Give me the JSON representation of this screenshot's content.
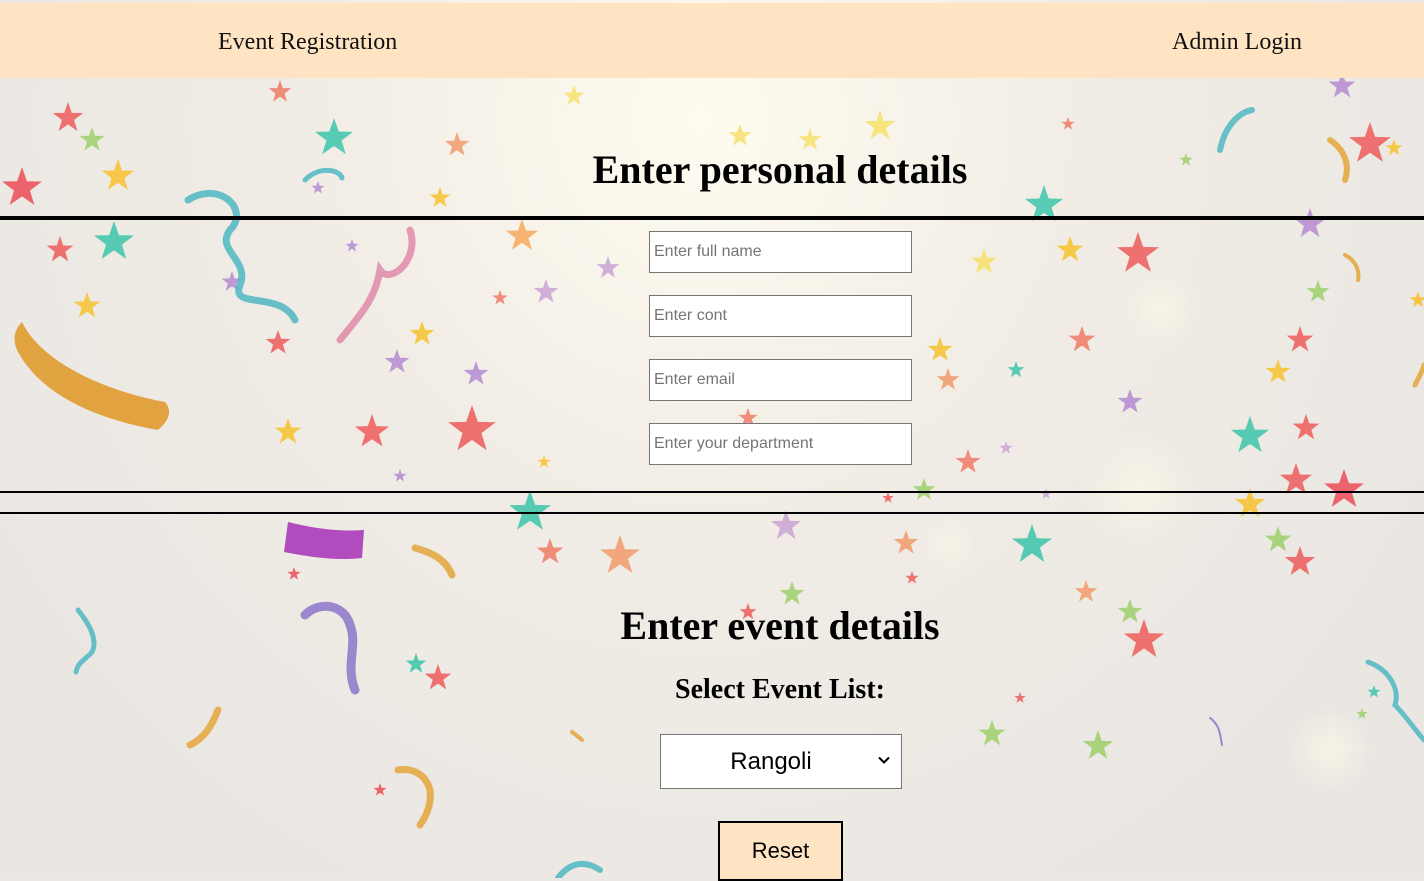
{
  "navbar": {
    "brand": "Event Registration",
    "admin_link": "Admin Login",
    "background": "#ffe4c4"
  },
  "personal": {
    "heading": "Enter personal details",
    "fields": [
      {
        "placeholder": "Enter full name",
        "value": ""
      },
      {
        "placeholder": "Enter cont",
        "value": ""
      },
      {
        "placeholder": "Enter email",
        "value": ""
      },
      {
        "placeholder": "Enter your department",
        "value": ""
      }
    ]
  },
  "event": {
    "heading": "Enter event details",
    "select_label": "Select Event List:",
    "selected": "Rangoli",
    "reset_label": "Reset"
  },
  "icons": {
    "select_chevron": "chevron-down-icon"
  }
}
